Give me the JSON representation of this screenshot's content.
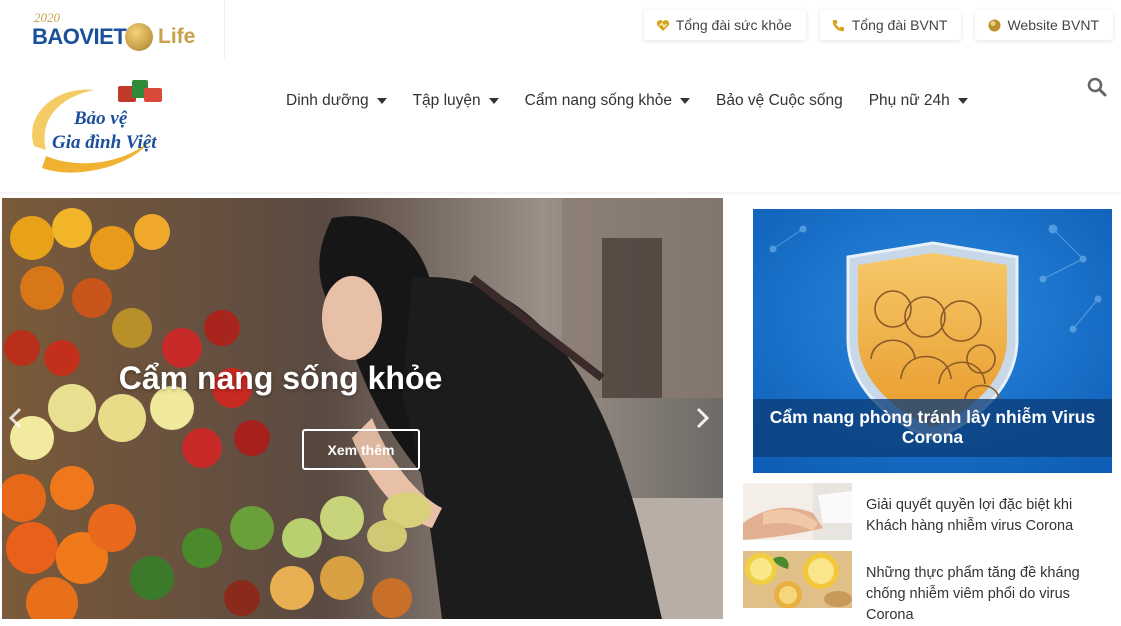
{
  "topbar": {
    "brand": {
      "year": "2020",
      "name": "BAOVIET",
      "suffix": "Life"
    },
    "links": [
      {
        "label": "Tổng đài sức khỏe",
        "icon": "heart-icon"
      },
      {
        "label": "Tổng đài BVNT",
        "icon": "phone-icon"
      },
      {
        "label": "Website BVNT",
        "icon": "globe-icon"
      }
    ]
  },
  "header": {
    "logo": {
      "line1": "Bảo vệ",
      "line2": "Gia đình Việt"
    },
    "nav": [
      {
        "label": "Dinh dưỡng",
        "has_dropdown": true
      },
      {
        "label": "Tập luyện",
        "has_dropdown": true
      },
      {
        "label": "Cẩm nang sống khỏe",
        "has_dropdown": true
      },
      {
        "label": "Bảo vệ Cuộc sống",
        "has_dropdown": false
      },
      {
        "label": "Phụ nữ 24h",
        "has_dropdown": true
      }
    ],
    "search_icon": "search-icon"
  },
  "hero": {
    "title": "Cẩm nang sống khỏe",
    "button": "Xem thêm"
  },
  "sidebar": {
    "feature": {
      "caption": "Cẩm nang phòng tránh lây nhiễm Virus Corona"
    },
    "news": [
      {
        "title": "Giải quyết quyền lợi đặc biệt khi Khách hàng nhiễm virus Corona"
      },
      {
        "title": "Những thực phẩm tăng đề kháng chống nhiễm viêm phổi do virus Corona"
      }
    ]
  },
  "colors": {
    "brand_blue": "#1a4f9c",
    "brand_gold": "#c9a14a",
    "feature_blue": "#1a73d1"
  }
}
